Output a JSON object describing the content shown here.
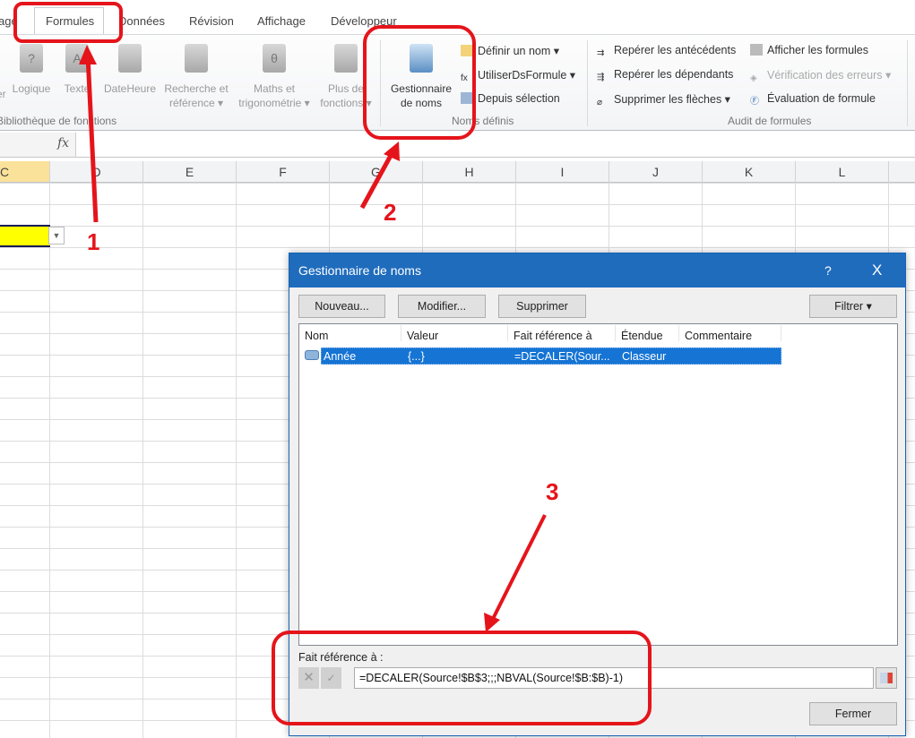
{
  "tabs": [
    "age",
    "Formules",
    "Données",
    "Révision",
    "Affichage",
    "Développeur"
  ],
  "ribbon": {
    "library": {
      "items": [
        {
          "label": "er",
          "dd": ""
        },
        {
          "label": "Logique"
        },
        {
          "label": "Texte"
        },
        {
          "label": "DateHeure"
        },
        {
          "label": "Recherche et",
          "label2": "référence"
        },
        {
          "label": "Maths et",
          "label2": "trigonométrie"
        },
        {
          "label": "Plus de",
          "label2": "fonctions"
        }
      ],
      "group": "Bibliothèque de fonctions"
    },
    "names": {
      "manager_line1": "Gestionnaire",
      "manager_line2": "de noms",
      "define": "Définir un nom",
      "use": "UtiliserDsFormule",
      "from_selection": "Depuis sélection",
      "group": "Noms définis"
    },
    "audit": {
      "precedents": "Repérer les antécédents",
      "dependents": "Repérer les dépendants",
      "remove_arrows": "Supprimer les flèches",
      "show_formulas": "Afficher les formules",
      "error_check": "Vérification des erreurs",
      "evaluate": "Évaluation de formule",
      "group": "Audit de formules"
    }
  },
  "formula_bar": {
    "fx": "fx",
    "value": ""
  },
  "columns": [
    "C",
    "D",
    "E",
    "F",
    "G",
    "H",
    "I",
    "J",
    "K",
    "L"
  ],
  "dialog": {
    "title": "Gestionnaire de noms",
    "help": "?",
    "close": "X",
    "buttons": {
      "new": "Nouveau...",
      "edit": "Modifier...",
      "delete": "Supprimer",
      "filter": "Filtrer"
    },
    "headers": [
      "Nom",
      "Valeur",
      "Fait référence à",
      "Étendue",
      "Commentaire"
    ],
    "rows": [
      {
        "name": "Année",
        "value": "{...}",
        "refers_to": "=DECALER(Sour...",
        "scope": "Classeur",
        "comment": ""
      }
    ],
    "refers_label": "Fait référence à :",
    "refers_value": "=DECALER(Source!$B$3;;;NBVAL(Source!$B:$B)-1)",
    "close_button": "Fermer"
  },
  "annotations": [
    "1",
    "2",
    "3"
  ],
  "colors": {
    "accent": "#1f6cbd",
    "annotation": "#e5141b",
    "selected_cell": "#ffff00"
  }
}
